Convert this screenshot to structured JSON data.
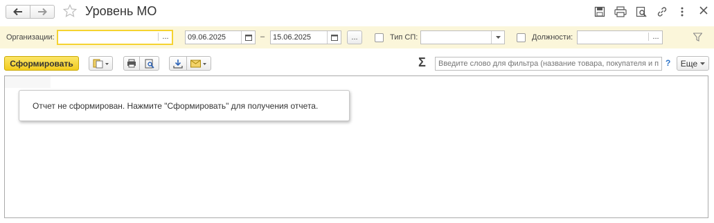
{
  "window": {
    "title": "Уровень МО"
  },
  "filters": {
    "organizations_label": "Организации:",
    "organizations_value": "",
    "ellipsis": "...",
    "date_from": "09.06.2025",
    "date_to": "15.06.2025",
    "date_separator": "–",
    "sp_type_label": "Тип СП:",
    "sp_type_value": "",
    "positions_label": "Должности:",
    "positions_value": ""
  },
  "toolbar": {
    "generate_label": "Сформировать",
    "search_placeholder": "Введите слово для фильтра (название товара, покупателя и п...",
    "help_label": "?",
    "more_label": "Еще",
    "sigma": "Σ"
  },
  "report": {
    "message": "Отчет не сформирован. Нажмите \"Сформировать\" для получения отчета."
  },
  "colors": {
    "accent": "#f5d330",
    "filter_bg": "#fbf6da",
    "help": "#2a72c8"
  },
  "icons": [
    "back-arrow-icon",
    "forward-arrow-icon",
    "star-icon",
    "save-icon",
    "print-icon",
    "preview-icon",
    "link-icon",
    "more-vert-icon",
    "calendar-icon",
    "filter-funnel-icon",
    "variants-icon",
    "download-icon",
    "email-icon",
    "sigma-icon",
    "dropdown-arrow-icon"
  ]
}
